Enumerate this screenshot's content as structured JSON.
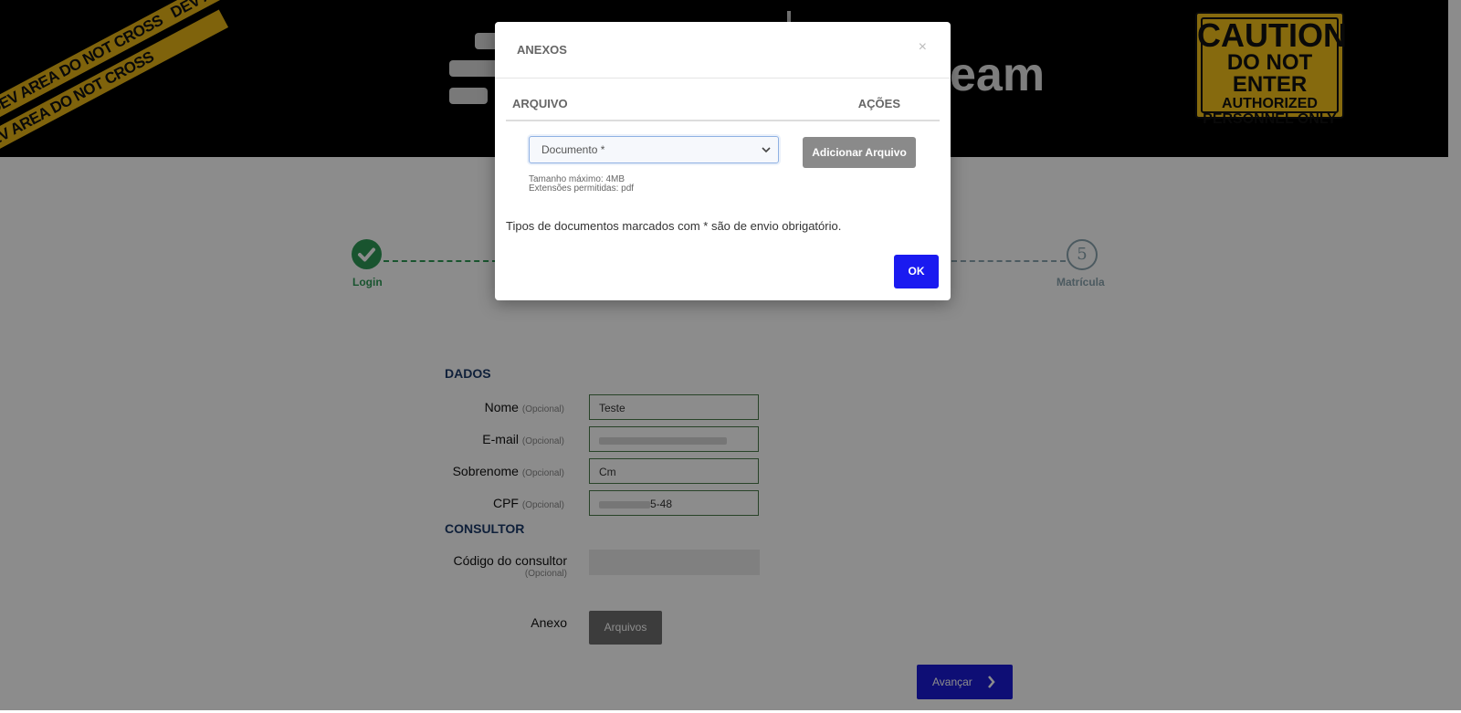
{
  "header": {
    "tape_text": "DEV AREA DO NOT CROSS",
    "logo_text": "eam",
    "caution_sign": {
      "line1": "CAUTION",
      "line2": "DO NOT ENTER",
      "line3": "AUTHORIZED",
      "line4": "PERSONNEL ONLY"
    }
  },
  "stepper": {
    "first_step_label": "Login",
    "last_step_number": "5",
    "last_step_label": "Matrícula"
  },
  "dados": {
    "title": "DADOS",
    "optional_tag": "(Opcional)",
    "fields": [
      {
        "label": "Nome",
        "value": "Teste"
      },
      {
        "label": "E-mail",
        "value": ""
      },
      {
        "label": "Sobrenome",
        "value": "Cm"
      },
      {
        "label": "CPF",
        "value": "5-48"
      }
    ]
  },
  "consultor": {
    "title": "CONSULTOR",
    "code_label": "Código do consultor",
    "optional_tag": "(Opcional)"
  },
  "anexo": {
    "label": "Anexo",
    "button_label": "Arquivos"
  },
  "avancar_label": "Avançar",
  "modal": {
    "title": "ANEXOS",
    "close_glyph": "×",
    "col_arquivo": "ARQUIVO",
    "col_acoes": "AÇÕES",
    "select_value": "Documento *",
    "add_button": "Adicionar Arquivo",
    "max_size": "Tamanho máximo: 4MB",
    "extensions": "Extensões permitidas: pdf",
    "note": "Tipos de documentos marcados com * são de envio obrigatório.",
    "ok_label": "OK"
  },
  "colors": {
    "accent_blue": "#1a1af0",
    "success_green": "#2e9a57",
    "caution_yellow": "#f4c21a"
  }
}
